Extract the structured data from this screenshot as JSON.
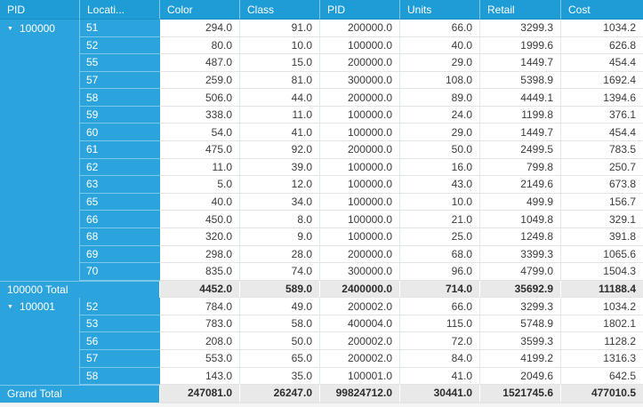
{
  "grid": {
    "columns": [
      {
        "key": "pid-group",
        "label": "PID"
      },
      {
        "key": "location",
        "label": "Locati..."
      },
      {
        "key": "color",
        "label": "Color"
      },
      {
        "key": "class",
        "label": "Class"
      },
      {
        "key": "pid",
        "label": "PID"
      },
      {
        "key": "units",
        "label": "Units"
      },
      {
        "key": "retail",
        "label": "Retail"
      },
      {
        "key": "cost",
        "label": "Cost"
      }
    ],
    "expand_icon": "▼",
    "groups": [
      {
        "id": "100000",
        "expanded": true,
        "rows": [
          {
            "location": "51",
            "values": [
              "294.0",
              "91.0",
              "200000.0",
              "66.0",
              "3299.3",
              "1034.2"
            ]
          },
          {
            "location": "52",
            "values": [
              "80.0",
              "10.0",
              "100000.0",
              "40.0",
              "1999.6",
              "626.8"
            ]
          },
          {
            "location": "55",
            "values": [
              "487.0",
              "15.0",
              "200000.0",
              "29.0",
              "1449.7",
              "454.4"
            ]
          },
          {
            "location": "57",
            "values": [
              "259.0",
              "81.0",
              "300000.0",
              "108.0",
              "5398.9",
              "1692.4"
            ]
          },
          {
            "location": "58",
            "values": [
              "506.0",
              "44.0",
              "200000.0",
              "89.0",
              "4449.1",
              "1394.6"
            ]
          },
          {
            "location": "59",
            "values": [
              "338.0",
              "11.0",
              "100000.0",
              "24.0",
              "1199.8",
              "376.1"
            ]
          },
          {
            "location": "60",
            "values": [
              "54.0",
              "41.0",
              "100000.0",
              "29.0",
              "1449.7",
              "454.4"
            ]
          },
          {
            "location": "61",
            "values": [
              "475.0",
              "92.0",
              "200000.0",
              "50.0",
              "2499.5",
              "783.5"
            ]
          },
          {
            "location": "62",
            "values": [
              "11.0",
              "39.0",
              "100000.0",
              "16.0",
              "799.8",
              "250.7"
            ]
          },
          {
            "location": "63",
            "values": [
              "5.0",
              "12.0",
              "100000.0",
              "43.0",
              "2149.6",
              "673.8"
            ]
          },
          {
            "location": "65",
            "values": [
              "40.0",
              "34.0",
              "100000.0",
              "10.0",
              "499.9",
              "156.7"
            ]
          },
          {
            "location": "66",
            "values": [
              "450.0",
              "8.0",
              "100000.0",
              "21.0",
              "1049.8",
              "329.1"
            ]
          },
          {
            "location": "68",
            "values": [
              "320.0",
              "9.0",
              "100000.0",
              "25.0",
              "1249.8",
              "391.8"
            ]
          },
          {
            "location": "69",
            "values": [
              "298.0",
              "28.0",
              "200000.0",
              "68.0",
              "3399.3",
              "1065.6"
            ]
          },
          {
            "location": "70",
            "values": [
              "835.0",
              "74.0",
              "300000.0",
              "96.0",
              "4799.0",
              "1504.3"
            ]
          }
        ],
        "total_label": "100000 Total",
        "total_values": [
          "4452.0",
          "589.0",
          "2400000.0",
          "714.0",
          "35692.9",
          "11188.4"
        ]
      },
      {
        "id": "100001",
        "expanded": true,
        "rows": [
          {
            "location": "52",
            "values": [
              "784.0",
              "49.0",
              "200002.0",
              "66.0",
              "3299.3",
              "1034.2"
            ]
          },
          {
            "location": "53",
            "values": [
              "783.0",
              "58.0",
              "400004.0",
              "115.0",
              "5748.9",
              "1802.1"
            ]
          },
          {
            "location": "56",
            "values": [
              "208.0",
              "50.0",
              "200002.0",
              "72.0",
              "3599.3",
              "1128.2"
            ]
          },
          {
            "location": "57",
            "values": [
              "553.0",
              "65.0",
              "200002.0",
              "84.0",
              "4199.2",
              "1316.3"
            ]
          },
          {
            "location": "58",
            "values": [
              "143.0",
              "35.0",
              "100001.0",
              "41.0",
              "2049.6",
              "642.5"
            ]
          }
        ],
        "total_label": null,
        "total_values": null
      }
    ],
    "grand_total": {
      "label": "Grand Total",
      "values": [
        "247081.0",
        "26247.0",
        "99824712.0",
        "30441.0",
        "1521745.6",
        "477010.5"
      ]
    },
    "colors": {
      "header_bg": "#1E9CD6",
      "group_bg": "#2BA3DC",
      "header_text": "#FFFFFF",
      "cell_text": "#3B3B3B",
      "total_bg": "#E9E9E9",
      "total_text": "#2D2D2D",
      "grid_v_line": "#D9ECF7",
      "grid_h_line": "#E4E4E4",
      "white_line": "#FFFFFF"
    }
  }
}
